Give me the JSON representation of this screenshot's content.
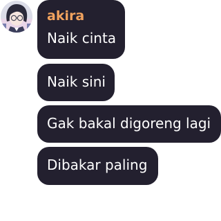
{
  "sender": {
    "username": "akira",
    "username_color": "#f2a35e"
  },
  "bubble_color": "#23202f",
  "messages": [
    {
      "text": "Naik cinta"
    },
    {
      "text": "Naik sini"
    },
    {
      "text": "Gak bakal digoreng lagi"
    },
    {
      "text": "Dibakar paling"
    }
  ]
}
